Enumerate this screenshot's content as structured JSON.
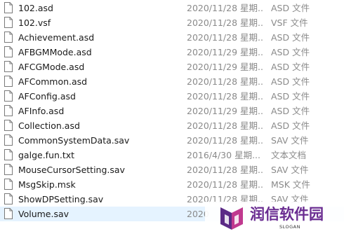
{
  "files": [
    {
      "name": "102.asd",
      "date": "2020/11/28 星期...",
      "type": "ASD 文件"
    },
    {
      "name": "102.vsf",
      "date": "2020/11/28 星期...",
      "type": "VSF 文件"
    },
    {
      "name": "Achievement.asd",
      "date": "2020/11/28 星期...",
      "type": "ASD 文件"
    },
    {
      "name": "AFBGMMode.asd",
      "date": "2020/11/29 星期...",
      "type": "ASD 文件"
    },
    {
      "name": "AFCGMode.asd",
      "date": "2020/11/29 星期...",
      "type": "ASD 文件"
    },
    {
      "name": "AFCommon.asd",
      "date": "2020/11/28 星期...",
      "type": "ASD 文件"
    },
    {
      "name": "AFConfig.asd",
      "date": "2020/11/28 星期...",
      "type": "ASD 文件"
    },
    {
      "name": "AFInfo.asd",
      "date": "2020/11/29 星期...",
      "type": "ASD 文件"
    },
    {
      "name": "Collection.asd",
      "date": "2020/11/28 星期...",
      "type": "ASD 文件"
    },
    {
      "name": "CommonSystemData.sav",
      "date": "2020/11/28 星期...",
      "type": "SAV 文件"
    },
    {
      "name": "galge.fun.txt",
      "date": "2016/4/30 星期...",
      "type": "文本文档"
    },
    {
      "name": "MouseCursorSetting.sav",
      "date": "2020/11/28 星期...",
      "type": "SAV 文件"
    },
    {
      "name": "MsgSkip.msk",
      "date": "2020/11/28 星期...",
      "type": "MSK 文件"
    },
    {
      "name": "ShowDPSetting.sav",
      "date": "2020/11/28 星期...",
      "type": "SAV 文件"
    },
    {
      "name": "Volume.sav",
      "date": "2020",
      "type": ""
    }
  ],
  "selected_index": 14,
  "watermark": {
    "title": "润信软件园",
    "slogan": "SLOGAN"
  },
  "colors": {
    "selection": "#e5f3ff",
    "secondary_text": "#8a8a8a",
    "brand_purple": "#6a2c91"
  }
}
